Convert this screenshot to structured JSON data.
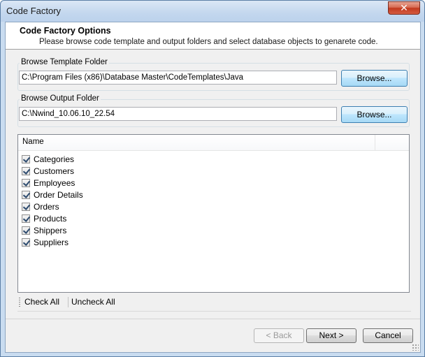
{
  "window": {
    "title": "Code Factory",
    "close_symbol": "✕"
  },
  "header": {
    "title": "Code Factory Options",
    "description": "Please browse code template and output folders and select database objects to genarete code."
  },
  "template_folder": {
    "label": "Browse Template Folder",
    "value": "C:\\Program Files (x86)\\Database Master\\CodeTemplates\\Java",
    "browse_label": "Browse..."
  },
  "output_folder": {
    "label": "Browse Output Folder",
    "value": "C:\\Nwind_10.06.10_22.54",
    "browse_label": "Browse..."
  },
  "objects_list": {
    "column_header": "Name",
    "items": [
      {
        "label": "Categories",
        "checked": true
      },
      {
        "label": "Customers",
        "checked": true
      },
      {
        "label": "Employees",
        "checked": true
      },
      {
        "label": "Order Details",
        "checked": true
      },
      {
        "label": "Orders",
        "checked": true
      },
      {
        "label": "Products",
        "checked": true
      },
      {
        "label": "Shippers",
        "checked": true
      },
      {
        "label": "Suppliers",
        "checked": true
      }
    ]
  },
  "toolbar": {
    "check_all": "Check All",
    "uncheck_all": "Uncheck All"
  },
  "footer": {
    "back": "< Back",
    "next": "Next >",
    "cancel": "Cancel"
  }
}
